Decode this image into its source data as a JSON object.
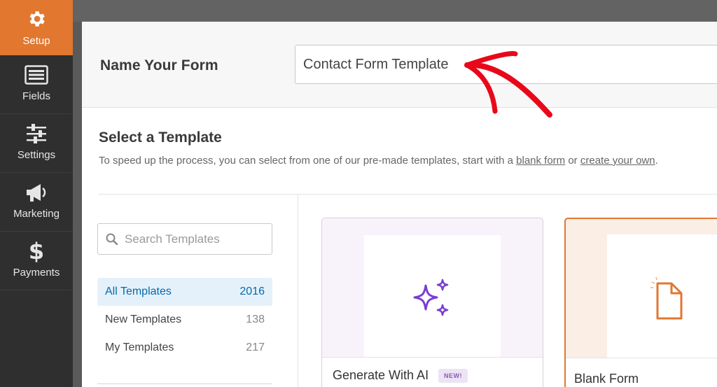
{
  "sidebar": {
    "items": [
      {
        "label": "Setup",
        "icon": "gear-icon",
        "active": true
      },
      {
        "label": "Fields",
        "icon": "fields-icon"
      },
      {
        "label": "Settings",
        "icon": "sliders-icon"
      },
      {
        "label": "Marketing",
        "icon": "megaphone-icon"
      },
      {
        "label": "Payments",
        "icon": "dollar-icon"
      }
    ]
  },
  "form_name": {
    "label": "Name Your Form",
    "value": "Contact Form Template"
  },
  "templates": {
    "title": "Select a Template",
    "description_prefix": "To speed up the process, you can select from one of our pre-made templates, start with a ",
    "blank_link": "blank form",
    "description_middle": " or ",
    "create_link": "create your own",
    "description_suffix": ".",
    "search_placeholder": "Search Templates",
    "categories": [
      {
        "name": "All Templates",
        "count": "2016",
        "active": true
      },
      {
        "name": "New Templates",
        "count": "138"
      },
      {
        "name": "My Templates",
        "count": "217"
      }
    ],
    "cards": [
      {
        "title": "Generate With AI",
        "badge": "NEW!",
        "icon": "sparkles-icon"
      },
      {
        "title": "Blank Form",
        "icon": "blank-document-icon"
      }
    ]
  },
  "colors": {
    "accent": "#e27730",
    "sidebar_bg": "#2f2f2f",
    "active_category_text": "#036aab",
    "ai_purple": "#7a3fd1",
    "annotation_red": "#e8081a"
  }
}
